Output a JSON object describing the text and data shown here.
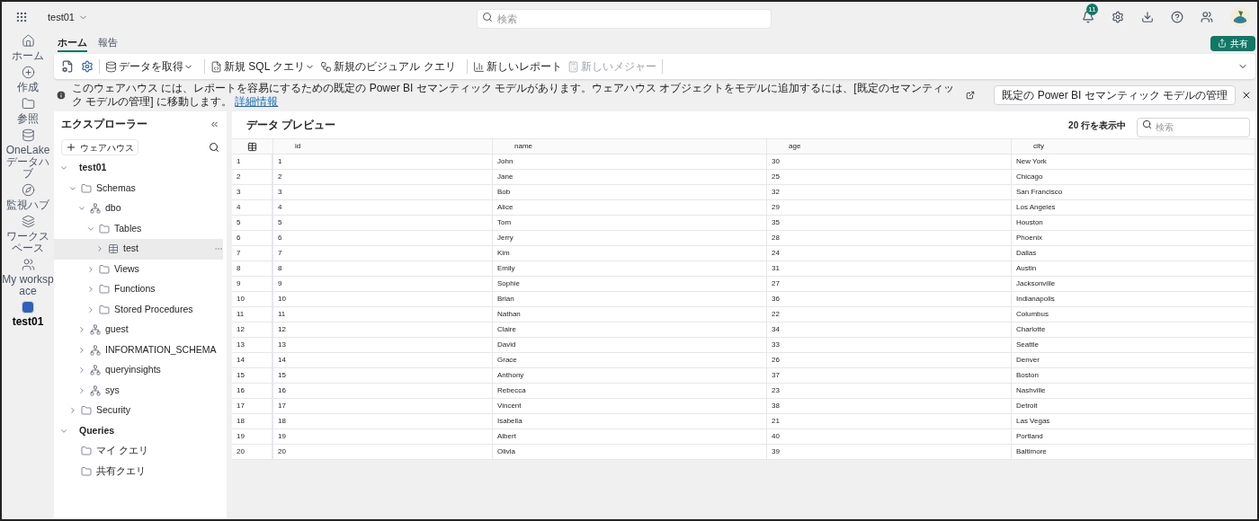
{
  "top_bar": {
    "workspace": "test01",
    "search_placeholder": "検索",
    "notification_count": "11"
  },
  "rail": [
    {
      "label": "ホーム",
      "selected": false
    },
    {
      "label": "作成",
      "selected": false
    },
    {
      "label": "参照",
      "selected": false
    },
    {
      "label": "OneLake データハブ",
      "selected": false
    },
    {
      "label": "監視ハブ",
      "selected": false
    },
    {
      "label": "ワークスペース",
      "selected": false
    },
    {
      "label": "My workspace",
      "selected": false
    },
    {
      "label": "test01",
      "selected": true
    }
  ],
  "tabs": [
    {
      "label": "ホーム",
      "selected": true
    },
    {
      "label": "報告",
      "selected": false
    }
  ],
  "share_button": "共有",
  "toolbar": [
    [
      {
        "label": "データを取得",
        "dropdown": true,
        "disabled": false
      }
    ],
    [
      {
        "label": "新規 SQL クエリ",
        "dropdown": true,
        "disabled": false
      },
      {
        "label": "新規のビジュアル クエリ",
        "dropdown": false,
        "disabled": false
      }
    ],
    [
      {
        "label": "新しいレポート",
        "dropdown": false,
        "disabled": false
      },
      {
        "label": "新しいメジャー",
        "dropdown": false,
        "disabled": true
      }
    ]
  ],
  "info_bar": {
    "message": "このウェアハウス には、レポートを容易にするための既定の Power BI セマンティック モデルがあります。ウェアハウス オブジェクトをモデルに追加するには、[既定のセマンティック モデルの管理] に移動します。",
    "link": "詳細情報",
    "button": "既定の Power BI セマンティック モデルの管理"
  },
  "explorer": {
    "title": "エクスプローラー",
    "add_button": "ウェアハウス",
    "tree": [
      {
        "label": "test01",
        "kind": "heading",
        "expanded": true,
        "selected": false,
        "children": [
          {
            "label": "Schemas",
            "kind": "folder",
            "expanded": true,
            "selected": false,
            "children": [
              {
                "label": "dbo",
                "kind": "schema",
                "expanded": true,
                "selected": false,
                "children": [
                  {
                    "label": "Tables",
                    "kind": "folder",
                    "expanded": true,
                    "selected": false,
                    "children": [
                      {
                        "label": "test",
                        "kind": "table",
                        "expanded": false,
                        "selected": true
                      }
                    ]
                  },
                  {
                    "label": "Views",
                    "kind": "folder",
                    "expanded": false,
                    "selected": false
                  },
                  {
                    "label": "Functions",
                    "kind": "folder",
                    "expanded": false,
                    "selected": false
                  },
                  {
                    "label": "Stored Procedures",
                    "kind": "folder",
                    "expanded": false,
                    "selected": false
                  }
                ]
              },
              {
                "label": "guest",
                "kind": "schema",
                "expanded": false,
                "selected": false
              },
              {
                "label": "INFORMATION_SCHEMA",
                "kind": "schema",
                "expanded": false,
                "selected": false
              },
              {
                "label": "queryinsights",
                "kind": "schema",
                "expanded": false,
                "selected": false
              },
              {
                "label": "sys",
                "kind": "schema",
                "expanded": false,
                "selected": false
              }
            ]
          },
          {
            "label": "Security",
            "kind": "folder",
            "expanded": false,
            "selected": false
          }
        ]
      },
      {
        "label": "Queries",
        "kind": "heading",
        "expanded": true,
        "selected": false,
        "children": [
          {
            "label": "マイ クエリ",
            "kind": "folder",
            "selected": false
          },
          {
            "label": "共有クエリ",
            "kind": "folder",
            "selected": false
          }
        ]
      }
    ]
  },
  "preview": {
    "title": "データ プレビュー",
    "row_count": "20 行を表示中",
    "search_placeholder": "検索",
    "columns": [
      "",
      "id",
      "name",
      "age",
      "city"
    ],
    "rows": [
      [
        "1",
        "1",
        "John",
        "30",
        "New York"
      ],
      [
        "2",
        "2",
        "Jane",
        "25",
        "Chicago"
      ],
      [
        "3",
        "3",
        "Bob",
        "32",
        "San Francisco"
      ],
      [
        "4",
        "4",
        "Alice",
        "29",
        "Los Angeles"
      ],
      [
        "5",
        "5",
        "Tom",
        "35",
        "Houston"
      ],
      [
        "6",
        "6",
        "Jerry",
        "28",
        "Phoenix"
      ],
      [
        "7",
        "7",
        "Kim",
        "24",
        "Dallas"
      ],
      [
        "8",
        "8",
        "Emily",
        "31",
        "Austin"
      ],
      [
        "9",
        "9",
        "Sophie",
        "27",
        "Jacksonville"
      ],
      [
        "10",
        "10",
        "Brian",
        "36",
        "Indianapolis"
      ],
      [
        "11",
        "11",
        "Nathan",
        "22",
        "Columbus"
      ],
      [
        "12",
        "12",
        "Claire",
        "34",
        "Charlotte"
      ],
      [
        "13",
        "13",
        "David",
        "33",
        "Seattle"
      ],
      [
        "14",
        "14",
        "Grace",
        "26",
        "Denver"
      ],
      [
        "15",
        "15",
        "Anthony",
        "37",
        "Boston"
      ],
      [
        "16",
        "16",
        "Rebecca",
        "23",
        "Nashville"
      ],
      [
        "17",
        "17",
        "Vincent",
        "38",
        "Detroit"
      ],
      [
        "18",
        "18",
        "Isabella",
        "21",
        "Las Vegas"
      ],
      [
        "19",
        "19",
        "Albert",
        "40",
        "Portland"
      ],
      [
        "20",
        "20",
        "Olivia",
        "39",
        "Baltimore"
      ]
    ]
  }
}
